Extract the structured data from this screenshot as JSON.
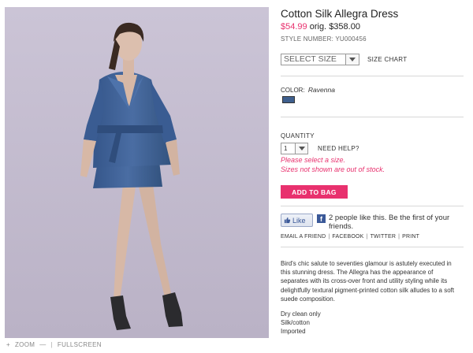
{
  "product": {
    "title": "Cotton Silk Allegra Dress",
    "sale_price": "$54.99",
    "orig_label": "orig.",
    "orig_price": "$358.00",
    "style_number": "STYLE NUMBER: YU000456",
    "photo_background": "#c4bdd0",
    "dress_color": "#3e5f8e"
  },
  "size": {
    "selected": "SELECT SIZE",
    "chart_label": "SIZE CHART",
    "dropdown_icon": "chevron-down-icon"
  },
  "color": {
    "label": "COLOR:",
    "name": "Ravenna",
    "swatch": "#3e5f8e"
  },
  "quantity": {
    "label": "QUANTITY",
    "value": "1",
    "help_label": "NEED HELP?"
  },
  "messages": {
    "select_size": "Please select a size.",
    "out_of_stock": "Sizes not shown are out of stock.",
    "accent": "#e8316e"
  },
  "cart": {
    "add_label": "ADD TO BAG"
  },
  "social": {
    "like_label": "Like",
    "like_text": "2 people like this. Be the first of your friends.",
    "links": [
      "EMAIL A FRIEND",
      "FACEBOOK",
      "TWITTER",
      "PRINT"
    ],
    "separator": "|"
  },
  "description": {
    "text": "Bird's chic salute to seventies glamour is astutely executed in this stunning dress. The Allegra has the appearance of separates with its cross-over front and utility styling while its delightfully textural pigment-printed cotton silk alludes to a soft suede composition.",
    "details": [
      "Dry clean only",
      "Silk/cotton",
      "Imported"
    ]
  },
  "image_controls": {
    "plus": "+",
    "zoom_label": "ZOOM",
    "minus": "—",
    "divider": "|",
    "fullscreen_label": "FULLSCREEN"
  }
}
